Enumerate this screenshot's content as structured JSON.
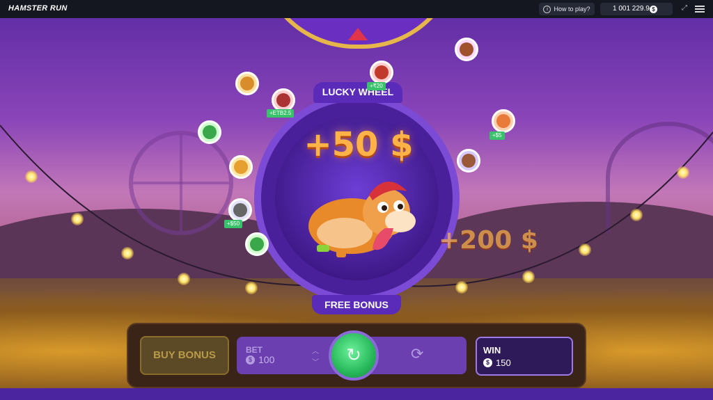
{
  "app": {
    "logo": "HAMSTER RUN"
  },
  "topbar": {
    "how_to_play": "How to play?",
    "balance": "1 001 229.9",
    "currency_symbol": "$"
  },
  "wheel": {
    "top_label": "LUCKY WHEEL",
    "bottom_label": "FREE BONUS",
    "current_prize": "+50 $",
    "next_prize": "+200 $"
  },
  "players": [
    {
      "chip": "+₹20"
    },
    {
      "chip": "+ETB2.5"
    },
    {
      "chip": "+$5"
    },
    {
      "chip": "+$50"
    }
  ],
  "controls": {
    "buy_bonus": "BUY BONUS",
    "bet_label": "BET",
    "bet_value": "100",
    "currency_symbol": "$",
    "spin_icon": "↻",
    "autoplay_icon": "⟳",
    "win_label": "WIN",
    "win_value": "150"
  },
  "colors": {
    "accent": "#6b3fb0",
    "spin": "#27b85a",
    "prize": "#ffb347",
    "bonus_chip": "#38c36a"
  }
}
